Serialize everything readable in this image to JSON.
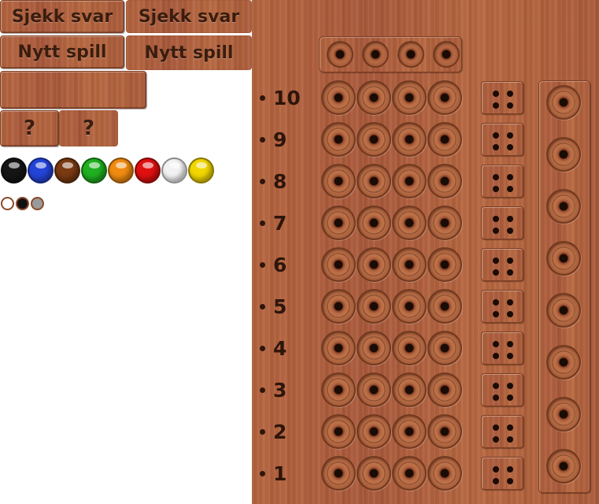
{
  "controls": {
    "check_answer_label": "Sjekk svar",
    "new_game_label": "Nytt spill",
    "help_label": "?"
  },
  "palette": {
    "colors": [
      {
        "name": "black",
        "hex": "#151515"
      },
      {
        "name": "blue",
        "hex": "#2444d8"
      },
      {
        "name": "brown",
        "hex": "#7a3a12"
      },
      {
        "name": "green",
        "hex": "#20b020"
      },
      {
        "name": "orange",
        "hex": "#f08a10"
      },
      {
        "name": "red",
        "hex": "#e01010"
      },
      {
        "name": "white",
        "hex": "#f2f2f2"
      },
      {
        "name": "yellow",
        "hex": "#f2d600"
      }
    ],
    "key_pegs": [
      {
        "name": "white",
        "hex": "#ffffff"
      },
      {
        "name": "black",
        "hex": "#111111"
      },
      {
        "name": "gray",
        "hex": "#9a9a9a"
      }
    ]
  },
  "board": {
    "rows": [
      "10",
      "9",
      "8",
      "7",
      "6",
      "5",
      "4",
      "3",
      "2",
      "1"
    ],
    "holes_per_row": 4,
    "secret_holes": 4,
    "side_holes": 8
  },
  "theme": {
    "wood": "#b0603b",
    "text": "#3a1d0e"
  }
}
